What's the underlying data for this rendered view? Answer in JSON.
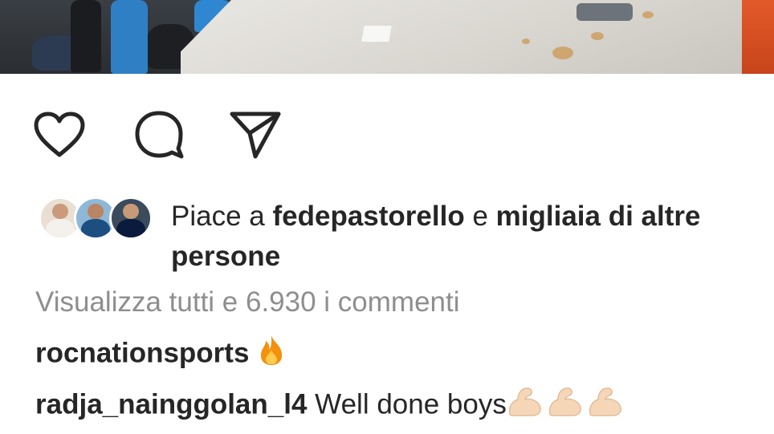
{
  "post": {
    "actions": {
      "like_icon": "heart-outline",
      "comment_icon": "speech-bubble",
      "share_icon": "paper-plane"
    },
    "likes": {
      "prefix": "Piace a",
      "user": "fedepastorello",
      "conjunction": "e",
      "others": "migliaia di altre persone"
    },
    "view_comments": "Visualizza tutti e 6.930 i commenti",
    "comments": [
      {
        "user": "rocnationsports",
        "text": "",
        "emoji": "fire"
      },
      {
        "user": "radja_nainggolan_l4",
        "text": "Well done boys",
        "emoji": "flexed-biceps-light-skin x3"
      }
    ]
  },
  "colors": {
    "text": "#262626",
    "secondary_text": "#8e8e8e",
    "background": "#ffffff",
    "fire": "#f4900c",
    "biceps": "#f5d7b8"
  }
}
